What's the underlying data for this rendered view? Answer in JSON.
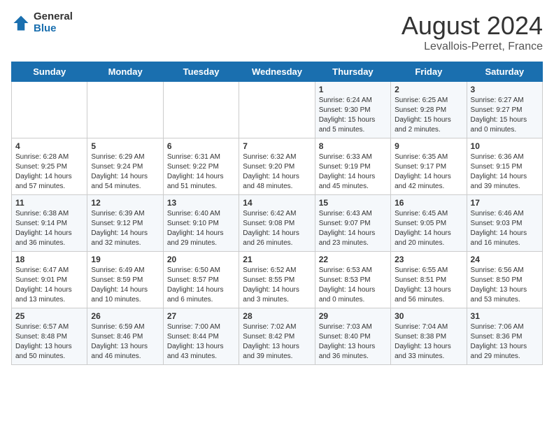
{
  "header": {
    "logo_general": "General",
    "logo_blue": "Blue",
    "month_year": "August 2024",
    "location": "Levallois-Perret, France"
  },
  "weekdays": [
    "Sunday",
    "Monday",
    "Tuesday",
    "Wednesday",
    "Thursday",
    "Friday",
    "Saturday"
  ],
  "weeks": [
    [
      {
        "day": "",
        "info": ""
      },
      {
        "day": "",
        "info": ""
      },
      {
        "day": "",
        "info": ""
      },
      {
        "day": "",
        "info": ""
      },
      {
        "day": "1",
        "info": "Sunrise: 6:24 AM\nSunset: 9:30 PM\nDaylight: 15 hours\nand 5 minutes."
      },
      {
        "day": "2",
        "info": "Sunrise: 6:25 AM\nSunset: 9:28 PM\nDaylight: 15 hours\nand 2 minutes."
      },
      {
        "day": "3",
        "info": "Sunrise: 6:27 AM\nSunset: 9:27 PM\nDaylight: 15 hours\nand 0 minutes."
      }
    ],
    [
      {
        "day": "4",
        "info": "Sunrise: 6:28 AM\nSunset: 9:25 PM\nDaylight: 14 hours\nand 57 minutes."
      },
      {
        "day": "5",
        "info": "Sunrise: 6:29 AM\nSunset: 9:24 PM\nDaylight: 14 hours\nand 54 minutes."
      },
      {
        "day": "6",
        "info": "Sunrise: 6:31 AM\nSunset: 9:22 PM\nDaylight: 14 hours\nand 51 minutes."
      },
      {
        "day": "7",
        "info": "Sunrise: 6:32 AM\nSunset: 9:20 PM\nDaylight: 14 hours\nand 48 minutes."
      },
      {
        "day": "8",
        "info": "Sunrise: 6:33 AM\nSunset: 9:19 PM\nDaylight: 14 hours\nand 45 minutes."
      },
      {
        "day": "9",
        "info": "Sunrise: 6:35 AM\nSunset: 9:17 PM\nDaylight: 14 hours\nand 42 minutes."
      },
      {
        "day": "10",
        "info": "Sunrise: 6:36 AM\nSunset: 9:15 PM\nDaylight: 14 hours\nand 39 minutes."
      }
    ],
    [
      {
        "day": "11",
        "info": "Sunrise: 6:38 AM\nSunset: 9:14 PM\nDaylight: 14 hours\nand 36 minutes."
      },
      {
        "day": "12",
        "info": "Sunrise: 6:39 AM\nSunset: 9:12 PM\nDaylight: 14 hours\nand 32 minutes."
      },
      {
        "day": "13",
        "info": "Sunrise: 6:40 AM\nSunset: 9:10 PM\nDaylight: 14 hours\nand 29 minutes."
      },
      {
        "day": "14",
        "info": "Sunrise: 6:42 AM\nSunset: 9:08 PM\nDaylight: 14 hours\nand 26 minutes."
      },
      {
        "day": "15",
        "info": "Sunrise: 6:43 AM\nSunset: 9:07 PM\nDaylight: 14 hours\nand 23 minutes."
      },
      {
        "day": "16",
        "info": "Sunrise: 6:45 AM\nSunset: 9:05 PM\nDaylight: 14 hours\nand 20 minutes."
      },
      {
        "day": "17",
        "info": "Sunrise: 6:46 AM\nSunset: 9:03 PM\nDaylight: 14 hours\nand 16 minutes."
      }
    ],
    [
      {
        "day": "18",
        "info": "Sunrise: 6:47 AM\nSunset: 9:01 PM\nDaylight: 14 hours\nand 13 minutes."
      },
      {
        "day": "19",
        "info": "Sunrise: 6:49 AM\nSunset: 8:59 PM\nDaylight: 14 hours\nand 10 minutes."
      },
      {
        "day": "20",
        "info": "Sunrise: 6:50 AM\nSunset: 8:57 PM\nDaylight: 14 hours\nand 6 minutes."
      },
      {
        "day": "21",
        "info": "Sunrise: 6:52 AM\nSunset: 8:55 PM\nDaylight: 14 hours\nand 3 minutes."
      },
      {
        "day": "22",
        "info": "Sunrise: 6:53 AM\nSunset: 8:53 PM\nDaylight: 14 hours\nand 0 minutes."
      },
      {
        "day": "23",
        "info": "Sunrise: 6:55 AM\nSunset: 8:51 PM\nDaylight: 13 hours\nand 56 minutes."
      },
      {
        "day": "24",
        "info": "Sunrise: 6:56 AM\nSunset: 8:50 PM\nDaylight: 13 hours\nand 53 minutes."
      }
    ],
    [
      {
        "day": "25",
        "info": "Sunrise: 6:57 AM\nSunset: 8:48 PM\nDaylight: 13 hours\nand 50 minutes."
      },
      {
        "day": "26",
        "info": "Sunrise: 6:59 AM\nSunset: 8:46 PM\nDaylight: 13 hours\nand 46 minutes."
      },
      {
        "day": "27",
        "info": "Sunrise: 7:00 AM\nSunset: 8:44 PM\nDaylight: 13 hours\nand 43 minutes."
      },
      {
        "day": "28",
        "info": "Sunrise: 7:02 AM\nSunset: 8:42 PM\nDaylight: 13 hours\nand 39 minutes."
      },
      {
        "day": "29",
        "info": "Sunrise: 7:03 AM\nSunset: 8:40 PM\nDaylight: 13 hours\nand 36 minutes."
      },
      {
        "day": "30",
        "info": "Sunrise: 7:04 AM\nSunset: 8:38 PM\nDaylight: 13 hours\nand 33 minutes."
      },
      {
        "day": "31",
        "info": "Sunrise: 7:06 AM\nSunset: 8:36 PM\nDaylight: 13 hours\nand 29 minutes."
      }
    ]
  ]
}
